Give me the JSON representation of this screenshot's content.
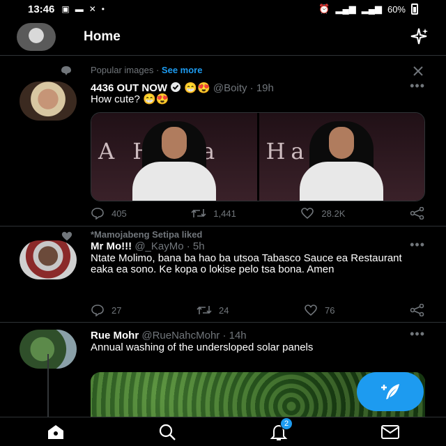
{
  "status_bar": {
    "time": "13:46",
    "battery": "60%"
  },
  "header": {
    "title": "Home"
  },
  "popular": {
    "label": "Popular images",
    "separator": "·",
    "see_more": "See more"
  },
  "tweets": [
    {
      "name": "4436 OUT NOW",
      "emoji": "😁😍",
      "handle": "@Boity",
      "time": "· 19h",
      "text": "How cute? 😁😍",
      "replies": "405",
      "retweets": "1,441",
      "likes": "28.2K",
      "media_text": [
        "A HaHa",
        "HaHa"
      ]
    },
    {
      "social_context": "*Mamojabeng Setipa liked",
      "name": "Mr Mo!!!",
      "handle": "@_KayMo",
      "time": "· 5h",
      "text": "Ntate Molimo, bana ba hao ba utsoa Tabasco Sauce ea Restaurant eaka ea sono. Ke kopa o lokise pelo tsa bona. Amen",
      "replies": "27",
      "retweets": "24",
      "likes": "76"
    },
    {
      "name": "Rue Mohr",
      "handle": "@RueNahcMohr",
      "time": "· 14h",
      "text": "Annual washing of the undersloped solar panels"
    }
  ],
  "bottom_nav": {
    "notifications_badge": "2"
  },
  "colors": {
    "accent": "#1d9bf0",
    "background": "#000000",
    "muted": "#71767b"
  }
}
